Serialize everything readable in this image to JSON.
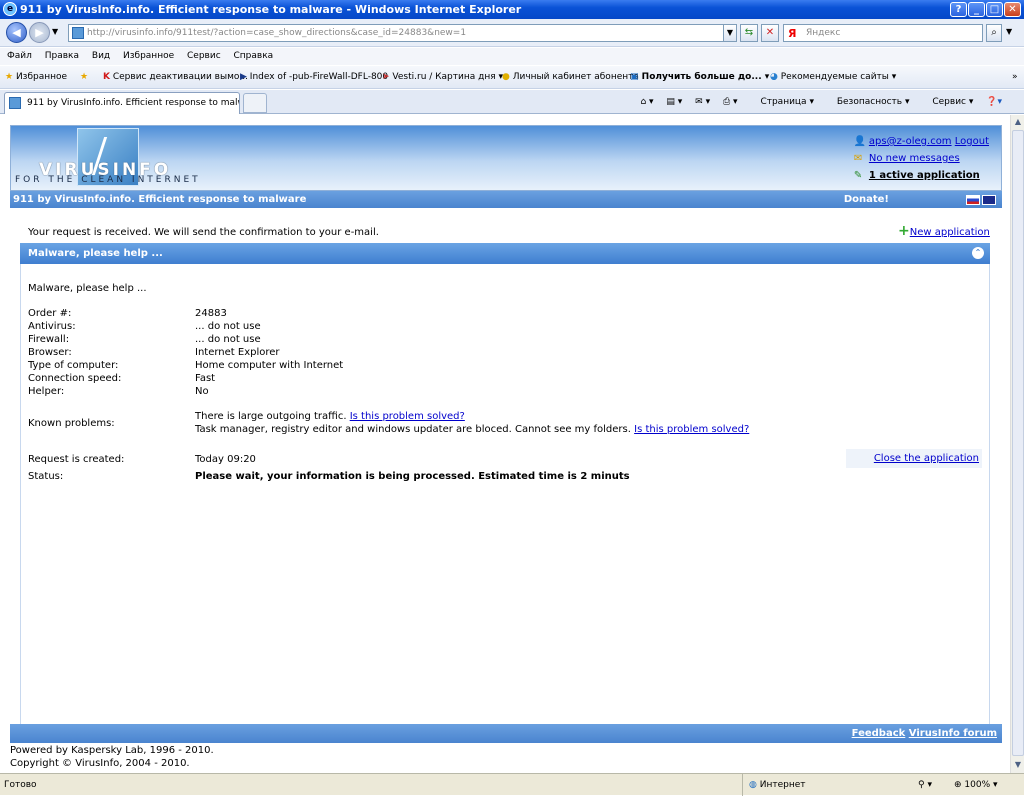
{
  "window": {
    "title": "911 by VirusInfo.info. Efficient response to malware - Windows Internet Explorer"
  },
  "browser": {
    "url": "http://virusinfo.info/911test/?action=case_show_directions&case_id=24883&new=1",
    "url_host": "virusinfo.info",
    "search_placeholder": "Яндекс",
    "search_logo": "Я",
    "menu": [
      "Файл",
      "Правка",
      "Вид",
      "Избранное",
      "Сервис",
      "Справка"
    ],
    "favorites_label": "Избранное",
    "favorites": [
      "Сервис деактивации вымо...",
      "Index of -pub-FireWall-DFL-800",
      "Vesti.ru / Картина дня",
      "Личный кабинет абонента",
      "Получить больше до...",
      "Рекомендуемые сайты"
    ],
    "tab_title": "911 by VirusInfo.info. Efficient response to malware",
    "commands": [
      "Страница",
      "Безопасность",
      "Сервис"
    ],
    "status_left": "Готово",
    "status_zone": "Интернет",
    "zoom": "100%"
  },
  "site": {
    "logo_text": "VIRUSINFO",
    "logo_sub": "FOR THE CLEAN INTERNET",
    "user_email": "aps@z-oleg.com",
    "logout": "Logout",
    "messages": "No new messages",
    "active_apps": "1 active application",
    "tagline": "911 by VirusInfo.info. Efficient response to malware",
    "donate": "Donate!",
    "confirmation": "Your request is received. We will send the confirmation to your e-mail.",
    "new_application": "New application",
    "section_title": "Malware, please help ...",
    "intro": "Malware, please help ...",
    "fields": [
      {
        "label": "Order #:",
        "value": "24883"
      },
      {
        "label": "Antivirus:",
        "value": "... do not use"
      },
      {
        "label": "Firewall:",
        "value": "... do not use"
      },
      {
        "label": "Browser:",
        "value": "Internet Explorer"
      },
      {
        "label": "Type of computer:",
        "value": "Home computer with Internet"
      },
      {
        "label": "Connection speed:",
        "value": "Fast"
      },
      {
        "label": "Helper:",
        "value": "No"
      }
    ],
    "known_problems_label": "Known problems:",
    "problem1": "There is large outgoing traffic.",
    "problem2": "Task manager, registry editor and windows updater are bloced. Cannot see my folders.",
    "solved_link": "Is this problem solved?",
    "created_label": "Request is created:",
    "created_value": "Today 09:20",
    "close_link": "Close the application",
    "status_label": "Status:",
    "status_value": "Please wait, your information is being processed. Estimated time is 2 minuts",
    "feedback": "Feedback",
    "forum": "VirusInfo forum",
    "powered": "Powered by Kaspersky Lab, 1996 - 2010.",
    "copyright": "Copyright © VirusInfo, 2004 - 2010."
  }
}
